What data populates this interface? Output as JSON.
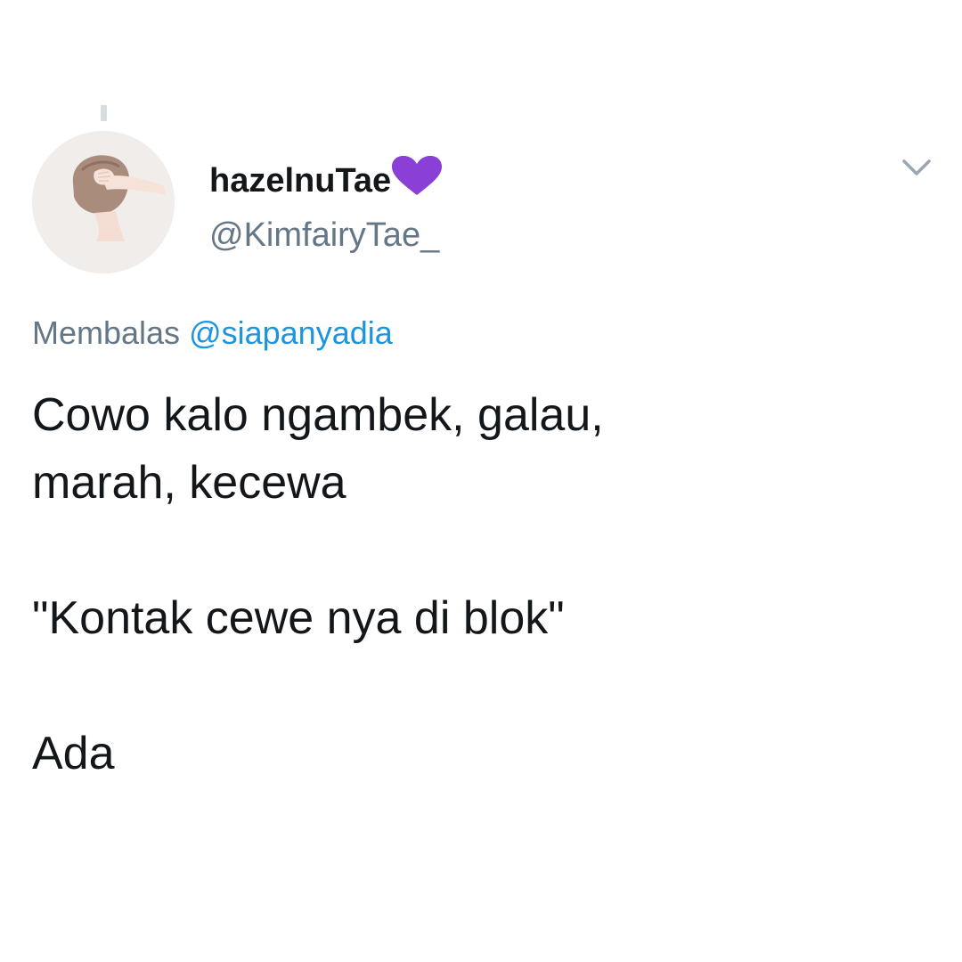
{
  "tweet": {
    "author": {
      "display_name": "hazelnuTae",
      "handle": "@KimfairyTae_"
    },
    "reply_context": {
      "prefix": "Membalas",
      "mention": "@siapanyadia"
    },
    "body": {
      "line1": "Cowo kalo ngambek, galau,",
      "line2": "marah, kecewa",
      "paragraph2": "\"Kontak cewe nya di blok\"",
      "paragraph3": "Ada"
    },
    "icons": {
      "name_emoji": "purple-heart-icon",
      "menu": "chevron-down-icon"
    },
    "colors": {
      "handle_gray": "#657786",
      "mention_blue": "#1b95e0",
      "heart_purple": "#8a3fd6",
      "text": "#14171a"
    }
  }
}
